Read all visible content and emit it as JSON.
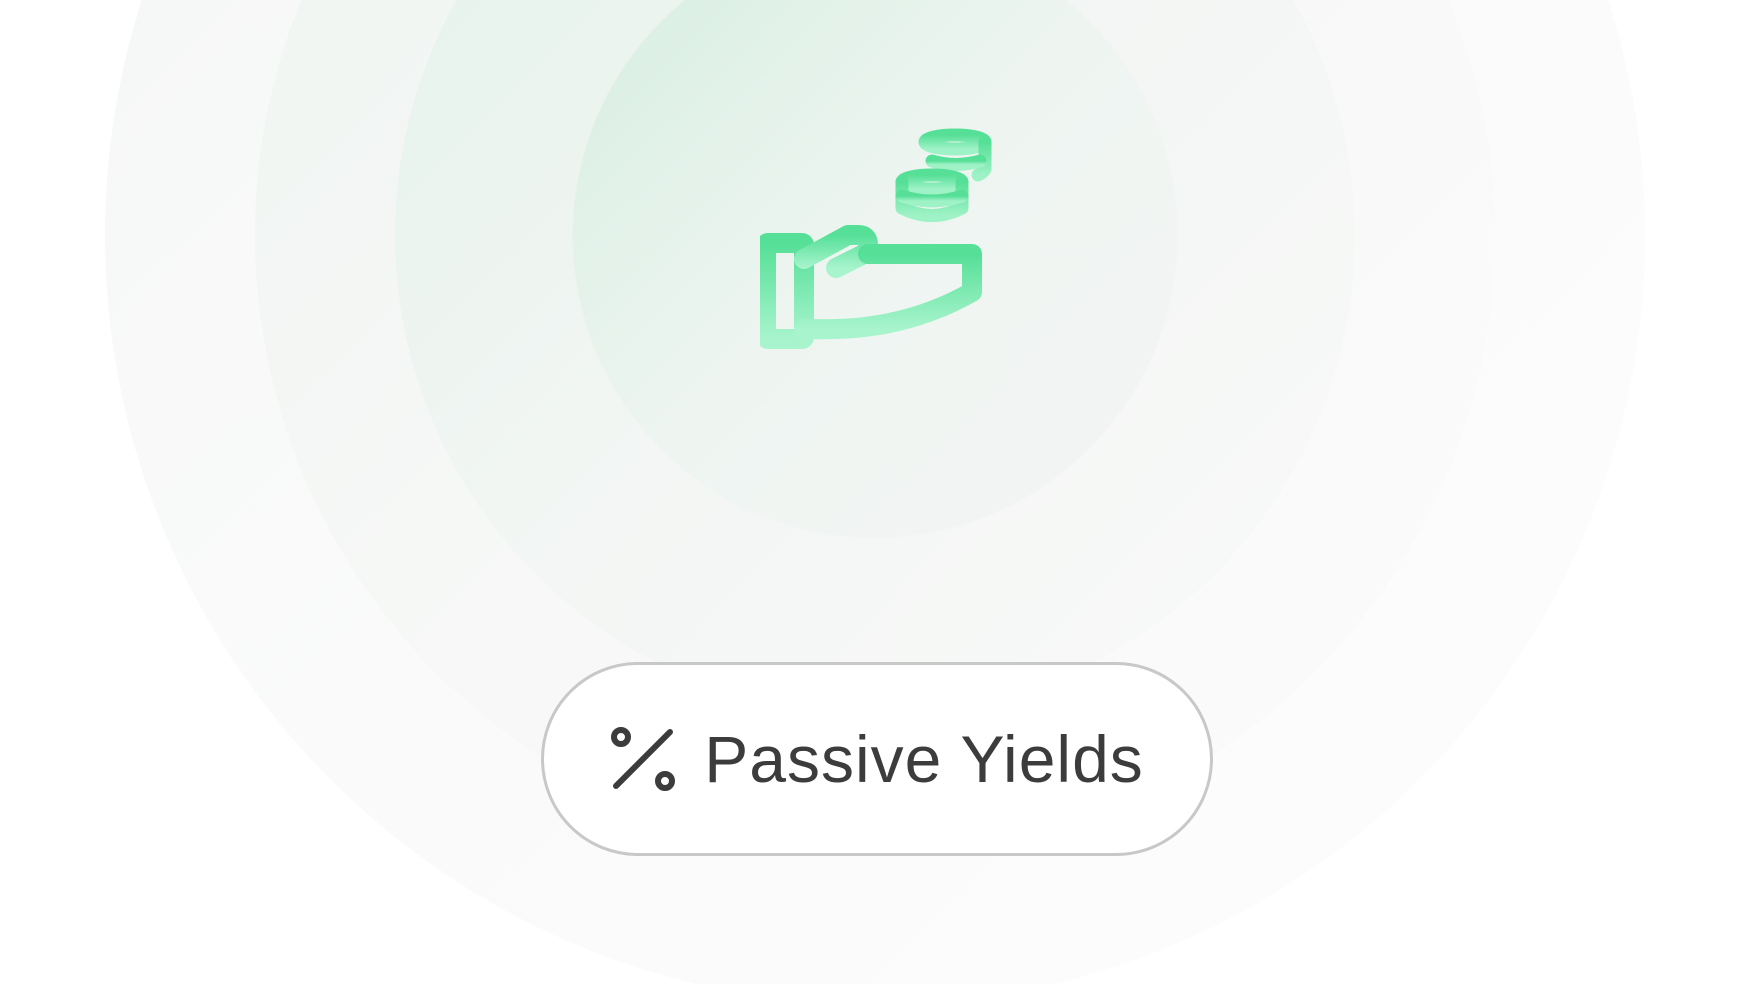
{
  "badge": {
    "icon": "percent-icon",
    "label": "Passive Yields"
  },
  "hero": {
    "icon": "hand-holding-coins-icon"
  },
  "colors": {
    "accent_top": "#55df97",
    "accent_bottom": "#a8f4cd",
    "text": "#3c3c3c",
    "pill_border": "#c8c8c8"
  }
}
